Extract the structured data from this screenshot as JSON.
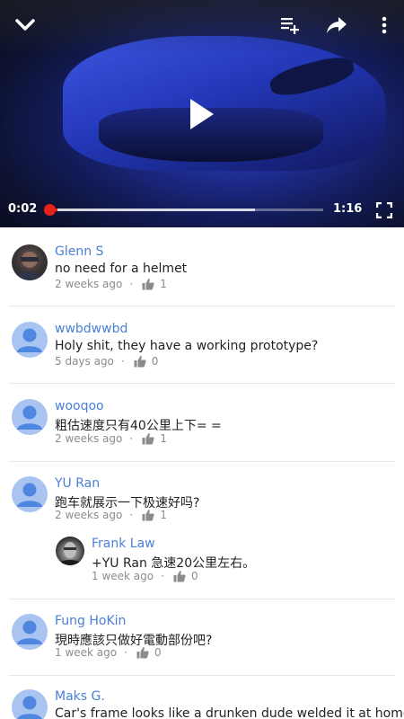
{
  "player": {
    "current_time": "0:02",
    "total_time": "1:16",
    "progress_fraction": 0.026,
    "buffered_fraction": 0.75,
    "accent_color": "#e62117",
    "icons": {
      "collapse": "chevron-down-icon",
      "add_to_playlist": "playlist-add-icon",
      "share": "share-icon",
      "more": "more-vert-icon",
      "play": "play-icon",
      "fullscreen": "fullscreen-icon"
    }
  },
  "comments": [
    {
      "author": "Glenn S",
      "text": "no need for a helmet",
      "time": "2 weeks ago",
      "likes": "1",
      "avatar": "photo"
    },
    {
      "author": "wwbdwwbd",
      "text": "Holy shit, they have a working prototype?",
      "time": "5 days ago",
      "likes": "0",
      "avatar": "default"
    },
    {
      "author": "wooqoo",
      "text": "粗估速度只有40公里上下= =",
      "time": "2 weeks ago",
      "likes": "1",
      "avatar": "default"
    },
    {
      "author": "YU Ran",
      "text": "跑车就展示一下极速好吗?",
      "time": "2 weeks ago",
      "likes": "1",
      "avatar": "default",
      "reply": {
        "author": "Frank Law",
        "text": "+YU Ran 急速20公里左右。",
        "time": "1 week ago",
        "likes": "0",
        "avatar": "photo"
      }
    },
    {
      "author": "Fung HoKin",
      "text": "現時應該只做好電動部份吧?",
      "time": "1 week ago",
      "likes": "0",
      "avatar": "default"
    },
    {
      "author": "Maks G.",
      "text": "Car's frame looks like a drunken dude welded it at home",
      "time": "",
      "likes": "",
      "avatar": "default"
    }
  ],
  "colors": {
    "author_link": "#4a7fd6",
    "meta_text": "#8c8c8c",
    "default_avatar": "#a9c4f0"
  }
}
